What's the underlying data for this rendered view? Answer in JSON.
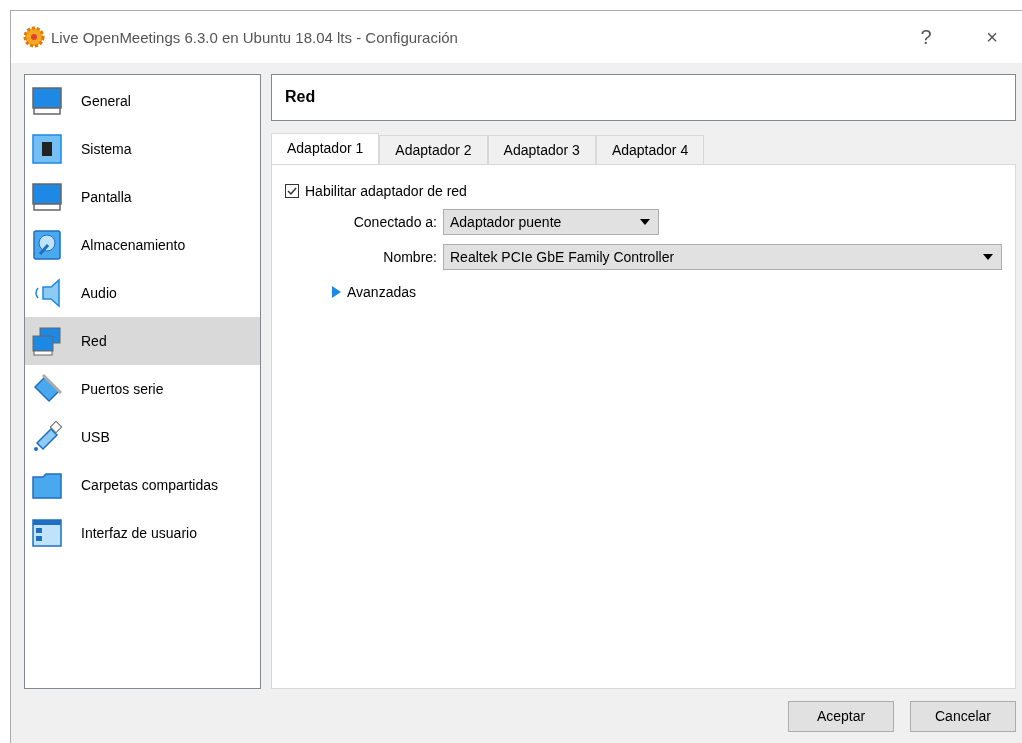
{
  "window": {
    "title": "Live OpenMeetings 6.3.0 en Ubuntu 18.04 lts - Configuración",
    "help": "?",
    "close": "×"
  },
  "sidebar": {
    "items": [
      {
        "label": "General",
        "selected": false
      },
      {
        "label": "Sistema",
        "selected": false
      },
      {
        "label": "Pantalla",
        "selected": false
      },
      {
        "label": "Almacenamiento",
        "selected": false
      },
      {
        "label": "Audio",
        "selected": false
      },
      {
        "label": "Red",
        "selected": true
      },
      {
        "label": "Puertos serie",
        "selected": false
      },
      {
        "label": "USB",
        "selected": false
      },
      {
        "label": "Carpetas compartidas",
        "selected": false
      },
      {
        "label": "Interfaz de usuario",
        "selected": false
      }
    ]
  },
  "page_title": "Red",
  "tabs": [
    {
      "label": "Adaptador 1",
      "selected": true
    },
    {
      "label": "Adaptador 2",
      "selected": false
    },
    {
      "label": "Adaptador 3",
      "selected": false
    },
    {
      "label": "Adaptador 4",
      "selected": false
    }
  ],
  "enable_adapter": {
    "label": "Habilitar adaptador de red",
    "checked": true
  },
  "attached_to": {
    "label": "Conectado a:",
    "value": "Adaptador puente"
  },
  "name": {
    "label": "Nombre:",
    "value": "Realtek PCIe GbE Family Controller"
  },
  "advanced": {
    "label": "Avanzadas",
    "expanded": false
  },
  "buttons": [
    "Aceptar",
    "Cancelar"
  ]
}
